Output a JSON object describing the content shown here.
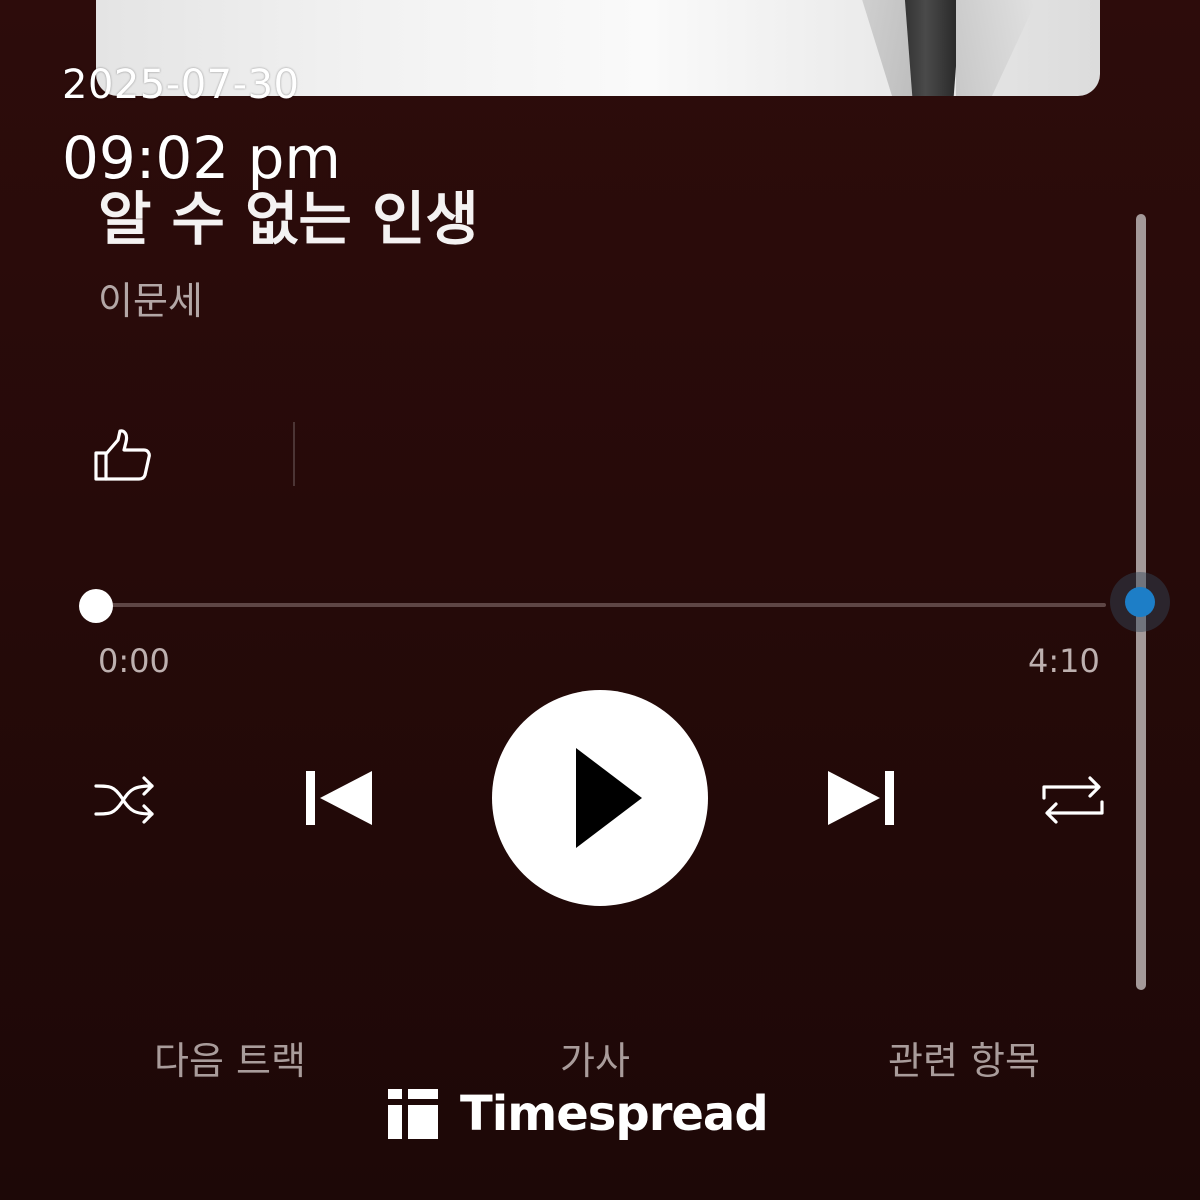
{
  "overlay": {
    "date": "2025-07-30",
    "time": "09:02 pm"
  },
  "track": {
    "title": "알 수 없는 인생",
    "artist": "이문세"
  },
  "progress": {
    "elapsed": "0:00",
    "total": "4:10",
    "fraction": 0.0
  },
  "controls": {
    "shuffle_icon": "shuffle-icon",
    "previous_icon": "skip-previous-icon",
    "play_icon": "play-icon",
    "next_icon": "skip-next-icon",
    "repeat_icon": "repeat-icon",
    "like_icon": "thumbs-up-icon"
  },
  "tabs": [
    {
      "label": "다음 트랙"
    },
    {
      "label": "가사"
    },
    {
      "label": "관련 항목"
    }
  ],
  "watermark": {
    "brand": "Timespread"
  },
  "colors": {
    "background": "#2d0c0b",
    "accent": "#1d7ec7",
    "secondary_text": "#b3a7a6"
  }
}
